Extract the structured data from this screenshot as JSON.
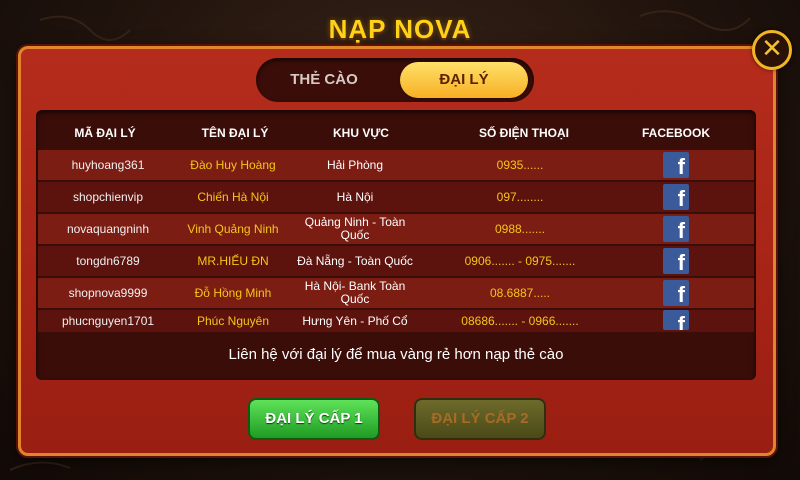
{
  "title": "NẠP NOVA",
  "close_label": "✕",
  "tabs": [
    {
      "label": "THẺ CÀO",
      "active": false
    },
    {
      "label": "ĐẠI LÝ",
      "active": true
    }
  ],
  "table": {
    "headers": [
      "MÃ ĐẠI LÝ",
      "TÊN ĐẠI LÝ",
      "KHU VỰC",
      "SỐ ĐIỆN THOẠI",
      "FACEBOOK"
    ],
    "rows": [
      {
        "id": "huyhoang361",
        "name": "Đào Huy Hoàng",
        "area": "Hải Phòng",
        "phone": "0935......",
        "facebook_icon": "facebook-icon"
      },
      {
        "id": "shopchienvip",
        "name": "Chiến Hà Nội",
        "area": "Hà Nội",
        "phone": "097........",
        "facebook_icon": "facebook-icon"
      },
      {
        "id": "novaquangninh",
        "name": "Vinh Quảng Ninh",
        "area": "Quảng Ninh - Toàn Quốc",
        "phone": "0988.......",
        "facebook_icon": "facebook-icon"
      },
      {
        "id": "tongdn6789",
        "name": "MR.HIẾU ĐN",
        "area": "Đà Nẵng - Toàn Quốc",
        "phone": "0906....... - 0975.......",
        "facebook_icon": "facebook-icon"
      },
      {
        "id": "shopnova9999",
        "name": "Đỗ Hồng Minh",
        "area": "Hà Nội- Bank Toàn Quốc",
        "phone": "08.6887.....",
        "facebook_icon": "facebook-icon"
      },
      {
        "id": "phucnguyen1701",
        "name": "Phúc Nguyên",
        "area": "Hưng Yên - Phố Cổ",
        "phone": "08686....... - 0966.......",
        "facebook_icon": "facebook-icon"
      }
    ]
  },
  "hint": "Liên hệ với đại lý để mua vàng rẻ hơn nạp thẻ cào",
  "buttons": {
    "level1": "ĐẠI LÝ CẤP 1",
    "level2": "ĐẠI LÝ CẤP 2"
  },
  "colors": {
    "accent_gold": "#ffd21a",
    "panel_red": "#b52c1c",
    "active_tab": "#f7b025",
    "facebook_blue": "#3b5a9a"
  }
}
